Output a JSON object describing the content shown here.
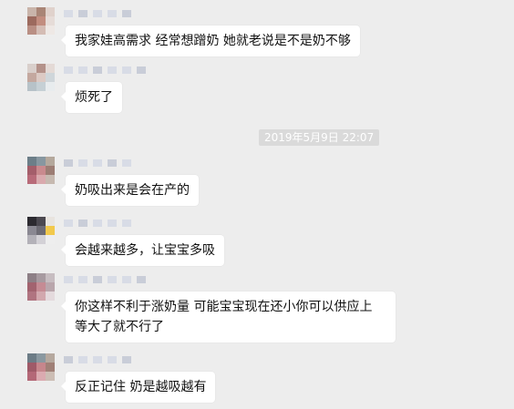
{
  "timestamp": "2019年5月9日 22:07",
  "messages": [
    {
      "text": "我家娃高需求 经常想蹭奶 她就老说是不是奶不够"
    },
    {
      "text": "烦死了"
    },
    {
      "text": "奶吸出来是会在产的"
    },
    {
      "text": "会越来越多，让宝宝多吸"
    },
    {
      "text": "你这样不利于涨奶量 可能宝宝现在还小你可以供应上 等大了就不行了"
    },
    {
      "text": "反正记住 奶是越吸越有"
    }
  ]
}
